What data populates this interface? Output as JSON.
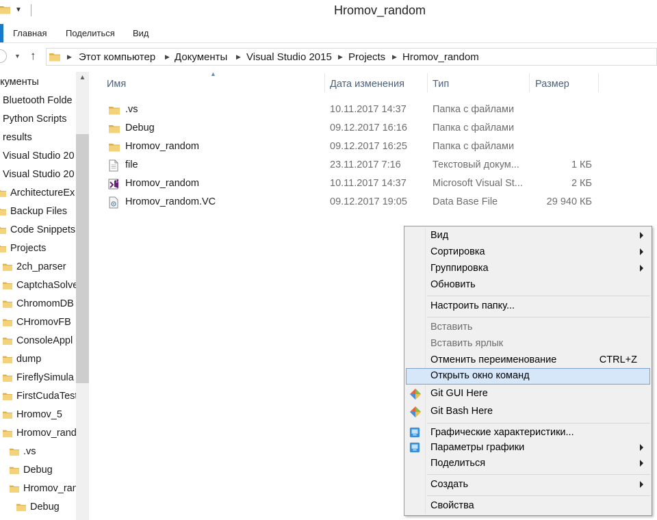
{
  "window": {
    "title": "Hromov_random"
  },
  "ribbon": {
    "tabs": [
      "Главная",
      "Поделиться",
      "Вид"
    ]
  },
  "address": {
    "crumbs": [
      "Этот компьютер",
      "Документы",
      "Visual Studio 2015",
      "Projects",
      "Hromov_random"
    ]
  },
  "nav": {
    "items": [
      "окументы",
      "Bluetooth Folde",
      "Python Scripts",
      "results",
      "Visual Studio 20",
      "Visual Studio 20",
      "ArchitectureEx",
      "Backup Files",
      "Code Snippets",
      "Projects",
      "2ch_parser",
      "CaptchaSolve",
      "ChromomDB",
      "CHromovFB",
      "ConsoleAppl",
      "dump",
      "FireflySimula",
      "FirstCudaTest",
      "Hromov_5",
      "Hromov_rand",
      ".vs",
      "Debug",
      "Hromov_ran",
      "Debug"
    ]
  },
  "columns": {
    "name": "Имя",
    "date": "Дата изменения",
    "type": "Тип",
    "size": "Размер"
  },
  "files": [
    {
      "name": ".vs",
      "date": "10.11.2017 14:37",
      "type": "Папка с файлами",
      "size": "",
      "icon": "folder-icon"
    },
    {
      "name": "Debug",
      "date": "09.12.2017 16:16",
      "type": "Папка с файлами",
      "size": "",
      "icon": "folder-icon"
    },
    {
      "name": "Hromov_random",
      "date": "09.12.2017 16:25",
      "type": "Папка с файлами",
      "size": "",
      "icon": "folder-icon"
    },
    {
      "name": "file",
      "date": "23.11.2017 7:16",
      "type": "Текстовый докум...",
      "size": "1 КБ",
      "icon": "text-file-icon"
    },
    {
      "name": "Hromov_random",
      "date": "10.11.2017 14:37",
      "type": "Microsoft Visual St...",
      "size": "2 КБ",
      "icon": "visual-studio-solution-icon"
    },
    {
      "name": "Hromov_random.VC",
      "date": "09.12.2017 19:05",
      "type": "Data Base File",
      "size": "29 940 КБ",
      "icon": "database-file-icon"
    }
  ],
  "context_menu": {
    "view": "Вид",
    "sort": "Сортировка",
    "group": "Группировка",
    "refresh": "Обновить",
    "customize": "Настроить папку...",
    "paste": "Вставить",
    "paste_shortcut": "Вставить ярлык",
    "undo_rename": "Отменить переименование",
    "undo_rename_key": "CTRL+Z",
    "open_cmd": "Открыть окно команд",
    "git_gui": "Git GUI Here",
    "git_bash": "Git Bash Here",
    "graphics_props": "Графические характеристики...",
    "graphics_options": "Параметры графики",
    "share": "Поделиться",
    "new": "Создать",
    "properties": "Свойства"
  },
  "colors": {
    "accent": "#1979ca",
    "menu_highlight": "#d5e7f8",
    "folder": "#e8c266"
  }
}
